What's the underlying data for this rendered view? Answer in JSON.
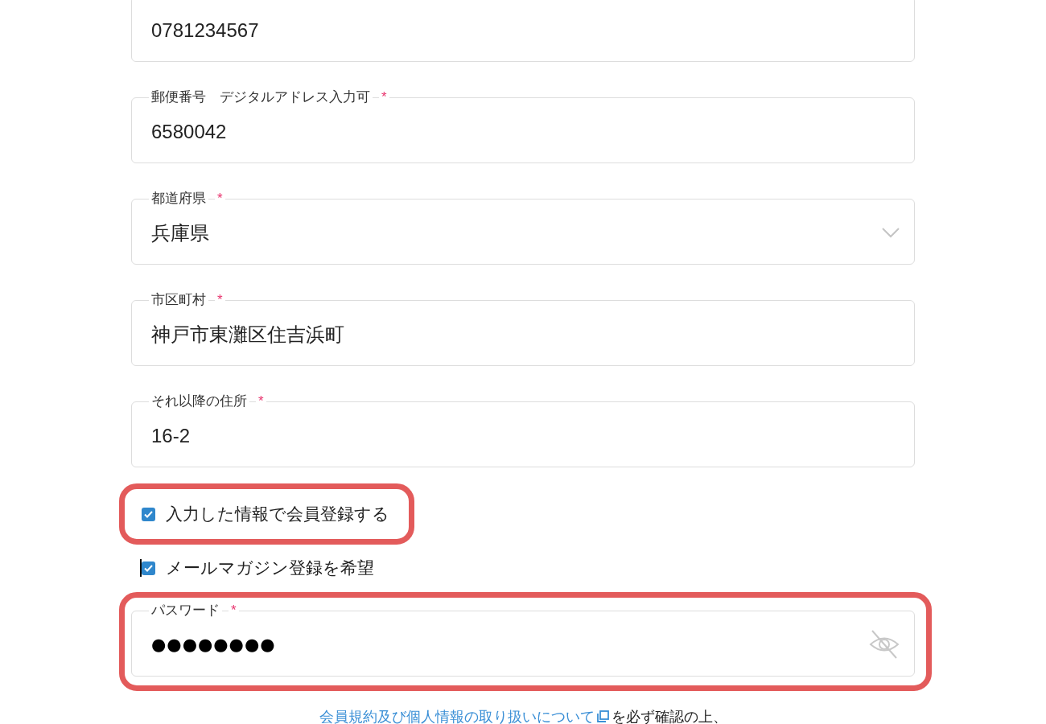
{
  "fields": [
    {
      "kind": "text",
      "value": "0781234567"
    },
    {
      "kind": "text",
      "label": "郵便番号　デジタルアドレス入力可",
      "required_mark": "*",
      "value": "6580042"
    },
    {
      "kind": "select",
      "label": "都道府県",
      "required_mark": "*",
      "value": "兵庫県"
    },
    {
      "kind": "text",
      "label": "市区町村",
      "required_mark": "*",
      "value": "神戸市東灘区住吉浜町"
    },
    {
      "kind": "text",
      "label": "それ以降の住所",
      "required_mark": "*",
      "value": "16-2"
    }
  ],
  "checkboxes": [
    {
      "label": "入力した情報で会員登録する",
      "checked": true,
      "highlighted": true,
      "text_cursor": false
    },
    {
      "label": "メールマガジン登録を希望",
      "checked": true,
      "highlighted": false,
      "text_cursor": true
    }
  ],
  "password": {
    "label": "パスワード",
    "required_mark": "*",
    "value": "●●●●●●●●",
    "reveal": false,
    "highlighted": true
  },
  "notice": {
    "link": "会員規約及び個人情報の取り扱いについて",
    "text": "を必ず確認の上、"
  }
}
